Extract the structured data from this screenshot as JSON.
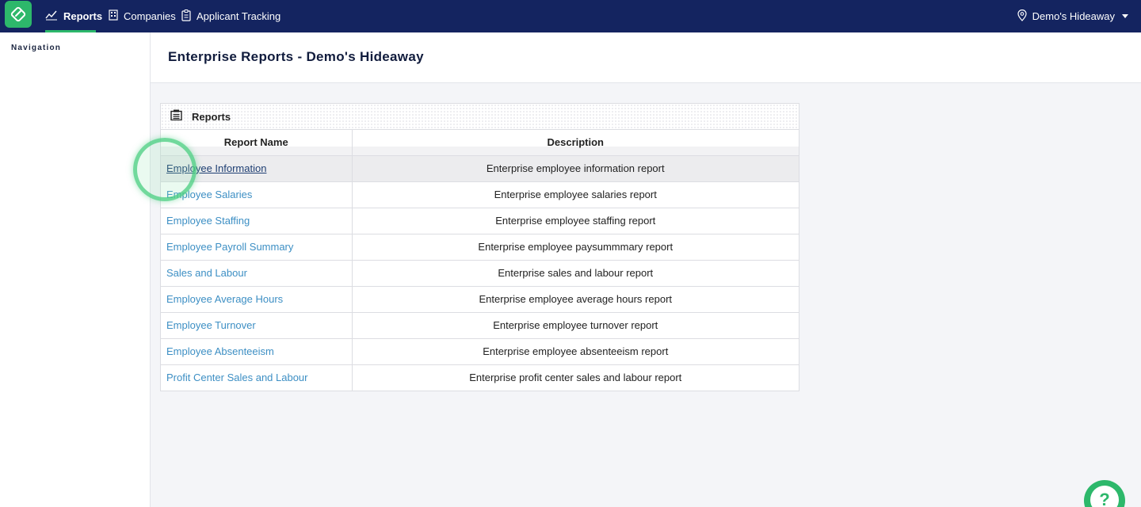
{
  "topbar": {
    "logo_icon": "app-logo-icon",
    "nav": [
      {
        "label": "Reports",
        "icon": "chart-line-icon",
        "active": true
      },
      {
        "label": "Companies",
        "icon": "building-icon",
        "active": false
      },
      {
        "label": "Applicant Tracking",
        "icon": "clipboard-icon",
        "active": false
      }
    ],
    "location": {
      "label": "Demo's Hideaway",
      "icon": "map-pin-icon"
    },
    "accent_color": "#2db86b",
    "background_color": "#142460"
  },
  "sidebar": {
    "title": "Navigation"
  },
  "page": {
    "title": "Enterprise Reports - Demo's Hideaway"
  },
  "reports_panel": {
    "title": "Reports",
    "icon": "report-list-icon",
    "columns": [
      "Report Name",
      "Description"
    ],
    "rows": [
      {
        "name": "Employee Information",
        "description": "Enterprise employee information report",
        "hovered": true
      },
      {
        "name": "Employee Salaries",
        "description": "Enterprise employee salaries report"
      },
      {
        "name": "Employee Staffing",
        "description": "Enterprise employee staffing report"
      },
      {
        "name": "Employee Payroll Summary",
        "description": "Enterprise employee paysummmary report"
      },
      {
        "name": "Sales and Labour",
        "description": "Enterprise sales and labour report"
      },
      {
        "name": "Employee Average Hours",
        "description": "Enterprise employee average hours report"
      },
      {
        "name": "Employee Turnover",
        "description": "Enterprise employee turnover report"
      },
      {
        "name": "Employee Absenteeism",
        "description": "Enterprise employee absenteeism report"
      },
      {
        "name": "Profit Center Sales and Labour",
        "description": "Enterprise profit center sales and labour report"
      }
    ]
  },
  "help_button": {
    "label": "?",
    "icon": "help-icon"
  }
}
